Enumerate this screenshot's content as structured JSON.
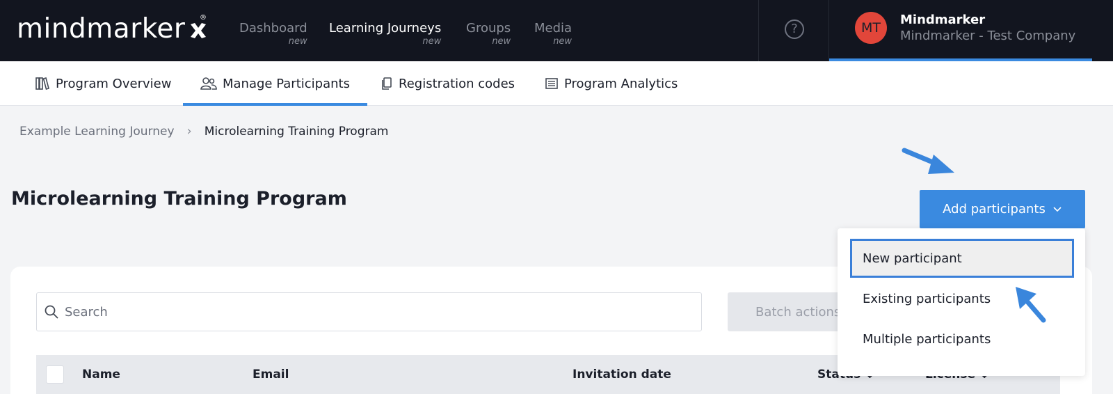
{
  "app": {
    "logo_text": "mindmarker",
    "logo_reg": "®"
  },
  "nav": [
    {
      "label": "Dashboard",
      "sub": "new"
    },
    {
      "label": "Learning Journeys",
      "sub": "new"
    },
    {
      "label": "Groups",
      "sub": "new"
    },
    {
      "label": "Media",
      "sub": "new"
    }
  ],
  "help": {
    "icon": "question-circle-icon",
    "glyph": "?"
  },
  "user": {
    "initials": "MT",
    "name": "Mindmarker",
    "company": "Mindmarker - Test Company",
    "avatar_color": "#e2463a"
  },
  "tabs": [
    {
      "label": "Program Overview",
      "icon": "books-icon"
    },
    {
      "label": "Manage Participants",
      "icon": "users-icon"
    },
    {
      "label": "Registration codes",
      "icon": "copy-icon"
    },
    {
      "label": "Program Analytics",
      "icon": "list-icon"
    }
  ],
  "breadcrumb": {
    "parent": "Example Learning Journey",
    "separator": "›",
    "current": "Microlearning Training Program"
  },
  "page": {
    "title": "Microlearning Training Program",
    "add_button": "Add participants"
  },
  "dropdown": {
    "items": [
      "New participant",
      "Existing participants",
      "Multiple participants"
    ]
  },
  "search": {
    "placeholder": "Search"
  },
  "batch_actions": "Batch actions",
  "table": {
    "columns": [
      "Name",
      "Email",
      "Invitation date",
      "Status",
      "License"
    ],
    "sort_glyph": "↓"
  },
  "colors": {
    "accent": "#3a8ae0",
    "topbar": "#12151f",
    "annotation_arrow": "#3a86dc"
  }
}
